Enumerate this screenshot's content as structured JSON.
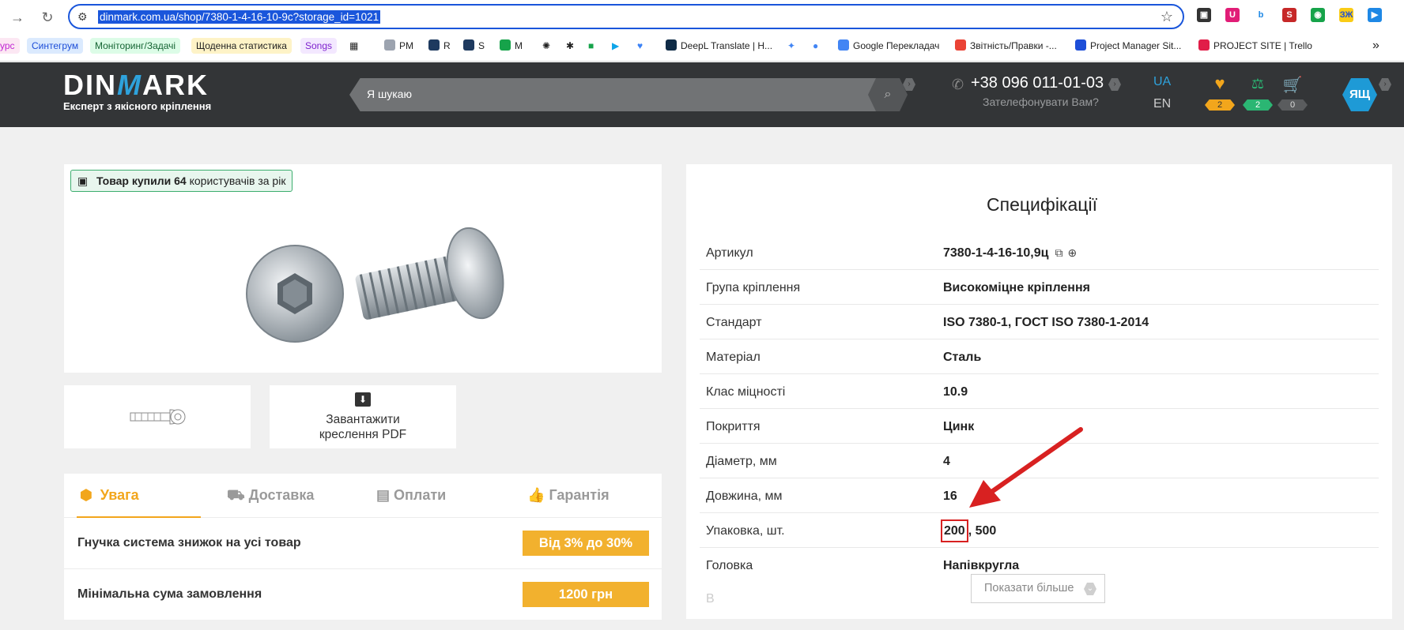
{
  "browser": {
    "url": "dinmark.com.ua/shop/7380-1-4-16-10-9c?storage_id=1021",
    "bookmarks": [
      {
        "label": "урс",
        "color": "#c026d3",
        "bg": "#fce7f3"
      },
      {
        "label": "Синтегрум",
        "color": "#1d4ed8",
        "bg": "#dbeafe"
      },
      {
        "label": "Моніторинг/Задачі",
        "color": "#166534",
        "bg": "#dcfce7"
      },
      {
        "label": "Щоденна статистика",
        "color": "#222222",
        "bg": "#fef3c7"
      },
      {
        "label": "Songs",
        "color": "#7e22ce",
        "bg": "#f3e8ff"
      },
      {
        "label": "PM",
        "icon_color": "#9ca3af"
      },
      {
        "label": "R",
        "icon_color": "#1e3a5f"
      },
      {
        "label": "S",
        "icon_color": "#1e3a5f"
      },
      {
        "label": "M",
        "icon_color": "#16a34a"
      },
      {
        "label": "DeepL Translate | H...",
        "icon_color": "#0f2b46"
      },
      {
        "label": "Google Перекладач",
        "icon_color": "#4285f4"
      },
      {
        "label": "Звітність/Правки -...",
        "icon_color": "#ea4335"
      },
      {
        "label": "Project Manager Sit...",
        "icon_color": "#1d4ed8"
      },
      {
        "label": "PROJECT SITE | Trello",
        "icon_color": "#e11d48"
      }
    ]
  },
  "header": {
    "logo_name_left": "DIN",
    "logo_name_m": "M",
    "logo_name_right": "ARK",
    "logo_tagline": "Експерт з якісного кріплення",
    "search_placeholder": "Я шукаю",
    "phone": "+38 096 011-01-03",
    "callback": "Зателефонувати Вам?",
    "lang_active": "UA",
    "lang_other": "EN",
    "favorites_count": "2",
    "compare_count": "2",
    "cart_count": "0",
    "user_initials": "ЯЩ",
    "colors": {
      "accent": "#2ea2dc",
      "header_bg": "#333537",
      "fav": "#f2a61c",
      "compare": "#2bb673"
    }
  },
  "product": {
    "buyers_bold": "Товар купили 64",
    "buyers_rest": " користувачів за рік",
    "pdf_download_line1": "Завантажити",
    "pdf_download_line2": "креслення PDF"
  },
  "info_tabs": [
    {
      "label": "Увага",
      "icon": "warning-icon"
    },
    {
      "label": "Доставка",
      "icon": "truck-icon"
    },
    {
      "label": "Оплати",
      "icon": "payment-icon"
    },
    {
      "label": "Гарантія",
      "icon": "thumbs-up-icon"
    }
  ],
  "info_rows": [
    {
      "label": "Гнучка система знижок на усі товар",
      "value": "Від 3% до 30%"
    },
    {
      "label": "Мінімальна сума замовлення",
      "value": "1200 грн"
    }
  ],
  "specs": {
    "title": "Специфікації",
    "rows": [
      {
        "key": "Артикул",
        "value": "7380-1-4-16-10,9ц"
      },
      {
        "key": "Група кріплення",
        "value": "Високоміцне кріплення"
      },
      {
        "key": "Стандарт",
        "value": "ISO 7380-1, ГОСТ ISO 7380-1-2014"
      },
      {
        "key": "Матеріал",
        "value": "Сталь"
      },
      {
        "key": "Клас міцності",
        "value": "10.9"
      },
      {
        "key": "Покриття",
        "value": "Цинк"
      },
      {
        "key": "Діаметр, мм",
        "value": "4"
      },
      {
        "key": "Довжина, мм",
        "value": "16"
      },
      {
        "key": "Упаковка, шт.",
        "value_highlight": "200",
        "value": ", 500"
      },
      {
        "key": "Головка",
        "value": "Напівкругла"
      }
    ],
    "show_more": "Показати більше"
  },
  "annotation": {
    "color": "#d82121"
  }
}
